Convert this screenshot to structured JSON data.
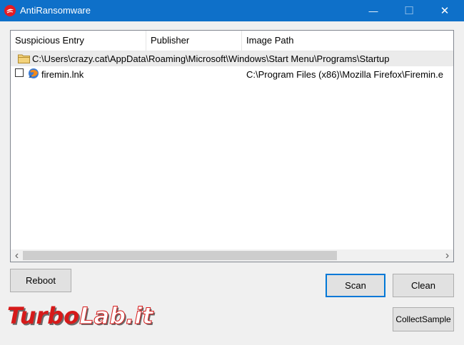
{
  "window": {
    "title": "AntiRansomware",
    "minimize_glyph": "—",
    "maximize_glyph": "☐",
    "close_glyph": "✕"
  },
  "list": {
    "columns": [
      "Suspicious Entry",
      "Publisher",
      "Image Path"
    ],
    "group_path": "C:\\Users\\crazy.cat\\AppData\\Roaming\\Microsoft\\Windows\\Start Menu\\Programs\\Startup",
    "entries": [
      {
        "name": "firemin.lnk",
        "publisher": "",
        "image_path": "C:\\Program Files (x86)\\Mozilla Firefox\\Firemin.e",
        "checked": false
      }
    ],
    "scroll_left_glyph": "‹",
    "scroll_right_glyph": "›"
  },
  "buttons": {
    "reboot": "Reboot",
    "scan": "Scan",
    "clean": "Clean",
    "collect_sample": "CollectSample"
  },
  "watermark": {
    "text_part1": "Turbo",
    "text_part2": "Lab.it"
  },
  "colors": {
    "titlebar": "#0e70c9",
    "accent": "#0078d7",
    "group_row": "#ebebeb"
  },
  "icons": {
    "app": "trend-micro-logo-icon",
    "folder": "folder-icon",
    "shortcut": "firefox-shortcut-icon"
  }
}
